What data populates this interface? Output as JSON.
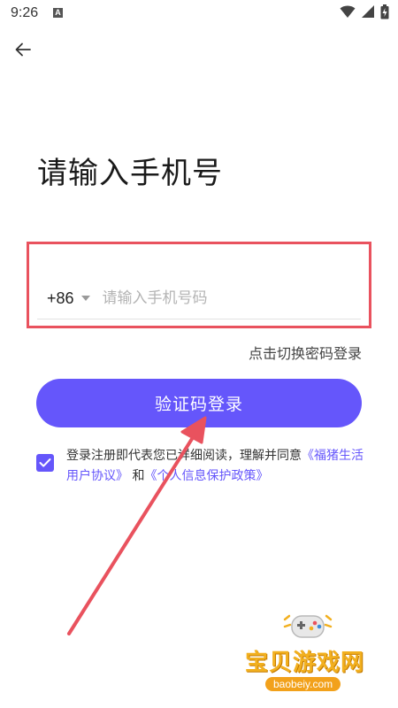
{
  "status_bar": {
    "time": "9:26",
    "notification_icon_letter": "A",
    "icons": [
      "wifi-icon",
      "signal-icon",
      "battery-icon"
    ]
  },
  "header": {
    "back_icon": "back-arrow-icon"
  },
  "title": "请输入手机号",
  "phone": {
    "country_code": "+86",
    "placeholder": "请输入手机号码",
    "value": ""
  },
  "switch_link": "点击切换密码登录",
  "login_button": "验证码登录",
  "agreement": {
    "checked": true,
    "prefix": "登录注册即代表您已详细阅读，理解并同意",
    "link_user_agreement": "《福猪生活用户协议》",
    "and": "和",
    "link_privacy": "《个人信息保护政策》"
  },
  "colors": {
    "accent": "#6556fb",
    "highlight": "#e9525e",
    "placeholder": "#b4b4b4"
  },
  "watermark": {
    "title": "宝贝游戏网",
    "url": "baobeiy.com"
  }
}
